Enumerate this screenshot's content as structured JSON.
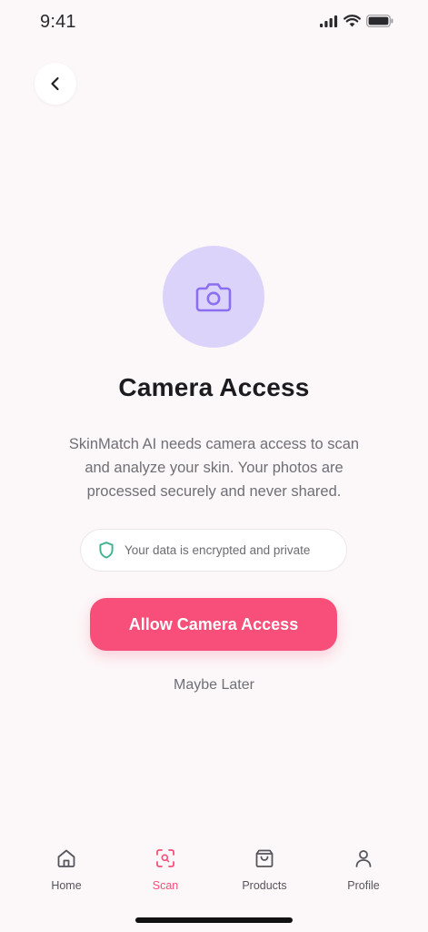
{
  "status_bar": {
    "time": "9:41"
  },
  "header": {
    "back_icon": "chevron-left-icon"
  },
  "main": {
    "icon": "camera-icon",
    "title": "Camera Access",
    "description": "SkinMatch AI needs camera access to scan and analyze your skin. Your photos are processed securely and never shared.",
    "privacy_note": "Your data is encrypted and private",
    "privacy_icon": "shield-icon",
    "allow_label": "Allow Camera Access",
    "later_label": "Maybe Later"
  },
  "tabs": [
    {
      "label": "Home",
      "icon": "home-icon",
      "active": false
    },
    {
      "label": "Scan",
      "icon": "scan-icon",
      "active": true
    },
    {
      "label": "Products",
      "icon": "shopping-bag-icon",
      "active": false
    },
    {
      "label": "Profile",
      "icon": "user-icon",
      "active": false
    }
  ],
  "colors": {
    "accent": "#f74f79",
    "camera_circle": "#dcd3fb",
    "camera_icon": "#8b6ff0",
    "shield": "#3fb28b",
    "background": "#fcf7f8"
  }
}
